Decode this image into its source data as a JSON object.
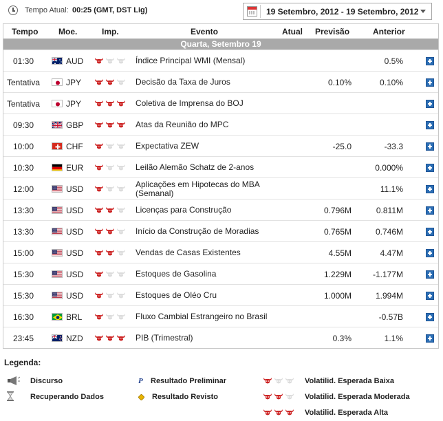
{
  "header": {
    "time_label": "Tempo Atual:",
    "time_value": "00:25 (GMT, DST Lig)",
    "date_range": "19 Setembro, 2012 - 19 Setembro, 2012"
  },
  "columns": {
    "time": "Tempo",
    "currency": "Moe.",
    "importance": "Imp.",
    "event": "Evento",
    "actual": "Atual",
    "forecast": "Previsão",
    "previous": "Anterior"
  },
  "day_label": "Quarta, Setembro 19",
  "colors": {
    "bull_active": "#cc2222",
    "bull_inactive": "#dcdcdc",
    "day_band": "#a9a9a9",
    "plus": "#2d6fb5"
  },
  "events": [
    {
      "time": "01:30",
      "flag": "australia-flag",
      "currency": "AUD",
      "importance": 1,
      "event": "Índice Principal WMI (Mensal)",
      "actual": "",
      "forecast": "",
      "previous": "0.5%"
    },
    {
      "time": "Tentativa",
      "flag": "japan-flag",
      "currency": "JPY",
      "importance": 2,
      "event": "Decisão da Taxa de Juros",
      "actual": "",
      "forecast": "0.10%",
      "previous": "0.10%"
    },
    {
      "time": "Tentativa",
      "flag": "japan-flag",
      "currency": "JPY",
      "importance": 3,
      "event": "Coletiva de Imprensa do BOJ",
      "actual": "",
      "forecast": "",
      "previous": ""
    },
    {
      "time": "09:30",
      "flag": "uk-flag",
      "currency": "GBP",
      "importance": 3,
      "event": "Atas da Reunião do MPC",
      "actual": "",
      "forecast": "",
      "previous": ""
    },
    {
      "time": "10:00",
      "flag": "switzerland-flag",
      "currency": "CHF",
      "importance": 1,
      "event": "Expectativa ZEW",
      "actual": "",
      "forecast": "-25.0",
      "previous": "-33.3"
    },
    {
      "time": "10:30",
      "flag": "germany-flag",
      "currency": "EUR",
      "importance": 1,
      "event": "Leilão Alemão Schatz de 2-anos",
      "actual": "",
      "forecast": "",
      "previous": "0.000%"
    },
    {
      "time": "12:00",
      "flag": "usa-flag",
      "currency": "USD",
      "importance": 1,
      "event": "Aplicações em Hipotecas do MBA (Semanal)",
      "actual": "",
      "forecast": "",
      "previous": "11.1%"
    },
    {
      "time": "13:30",
      "flag": "usa-flag",
      "currency": "USD",
      "importance": 2,
      "event": "Licenças para Construção",
      "actual": "",
      "forecast": "0.796M",
      "previous": "0.811M"
    },
    {
      "time": "13:30",
      "flag": "usa-flag",
      "currency": "USD",
      "importance": 2,
      "event": "Início da Construção de Moradias",
      "actual": "",
      "forecast": "0.765M",
      "previous": "0.746M"
    },
    {
      "time": "15:00",
      "flag": "usa-flag",
      "currency": "USD",
      "importance": 2,
      "event": "Vendas de Casas Existentes",
      "actual": "",
      "forecast": "4.55M",
      "previous": "4.47M"
    },
    {
      "time": "15:30",
      "flag": "usa-flag",
      "currency": "USD",
      "importance": 1,
      "event": "Estoques de Gasolina",
      "actual": "",
      "forecast": "1.229M",
      "previous": "-1.177M"
    },
    {
      "time": "15:30",
      "flag": "usa-flag",
      "currency": "USD",
      "importance": 1,
      "event": "Estoques de Oléo Cru",
      "actual": "",
      "forecast": "1.000M",
      "previous": "1.994M"
    },
    {
      "time": "16:30",
      "flag": "brazil-flag",
      "currency": "BRL",
      "importance": 1,
      "event": "Fluxo Cambial Estrangeiro no Brasil",
      "actual": "",
      "forecast": "",
      "previous": "-0.57B"
    },
    {
      "time": "23:45",
      "flag": "newzealand-flag",
      "currency": "NZD",
      "importance": 3,
      "event": "PIB (Trimestral)",
      "actual": "",
      "forecast": "0.3%",
      "previous": "1.1%"
    }
  ],
  "legend": {
    "title": "Legenda:",
    "speech": "Discurso",
    "retrieving": "Recuperando Dados",
    "preliminary": "Resultado Preliminar",
    "revised": "Resultado Revisto",
    "preliminary_glyph": "P",
    "vol_low": "Volatilid. Esperada Baixa",
    "vol_mod": "Volatilid. Esperada Moderada",
    "vol_high": "Volatilid. Esperada Alta"
  }
}
